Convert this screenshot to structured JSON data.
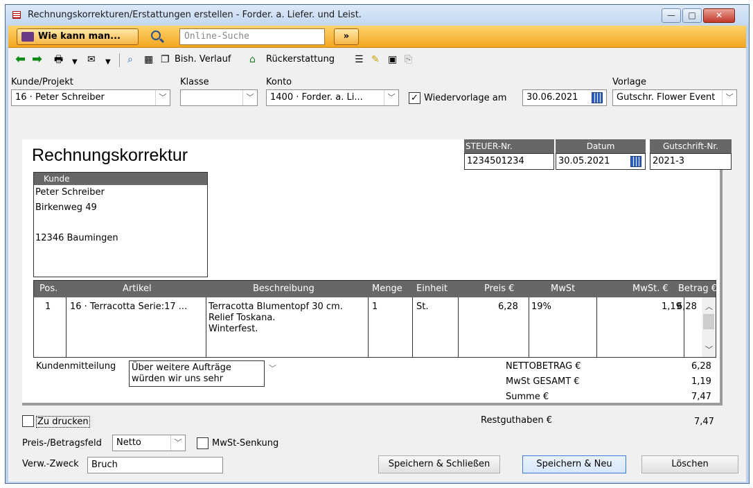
{
  "window": {
    "title": "Rechnungskorrekturen/Erstattungen erstellen - Forder. a. Liefer. und Leist.",
    "minimize": "—",
    "maximize": "□",
    "close": "✕"
  },
  "helpbar": {
    "howto": "Wie kann man...",
    "search_placeholder": "Online-Suche",
    "go": "»"
  },
  "toolbar": {
    "history": "Bish. Verlauf",
    "refund": "Rückerstattung"
  },
  "fields": {
    "customer_label": "Kunde/Projekt",
    "customer_value": "16 · Peter Schreiber",
    "class_label": "Klasse",
    "class_value": "",
    "account_label": "Konto",
    "account_value": "1400 · Forder. a. Li...",
    "recurring_label": "Wiedervorlage am",
    "recurring_checked": "✓",
    "recurring_date": "30.06.2021",
    "template_label": "Vorlage",
    "template_value": "Gutschr. Flower Event"
  },
  "form": {
    "title": "Rechnungskorrektur",
    "tax_label": "STEUER-Nr.",
    "tax_value": "1234501234",
    "date_label": "Datum",
    "date_value": "30.05.2021",
    "credit_label": "Gutschrift-Nr.",
    "credit_value": "2021-3",
    "customer_box_label": "Kunde",
    "address": [
      "Peter Schreiber",
      "Birkenweg 49",
      "",
      "12346 Baumingen"
    ]
  },
  "table": {
    "columns": [
      "Pos.",
      "Artikel",
      "Beschreibung",
      "Menge",
      "Einheit",
      "Preis €",
      "MwSt",
      "MwSt. €",
      "Betrag €"
    ],
    "rows": [
      {
        "pos": "1",
        "article": "16 · Terracotta Serie:17 ...",
        "description": [
          "Terracotta Blumentopf 30 cm.",
          "Relief Toskana.",
          "Winterfest."
        ],
        "qty": "1",
        "unit": "St.",
        "price": "6,28",
        "vat": "19%",
        "vat_amount": "1,19",
        "amount": "6,28"
      }
    ]
  },
  "totals": {
    "message_label": "Kundenmitteilung",
    "message_value": [
      "Über weitere Aufträge",
      "würden wir uns sehr"
    ],
    "net_label": "NETTOBETRAG €",
    "net_value": "6,28",
    "vat_label": "MwSt GESAMT €",
    "vat_value": "1,19",
    "sum_label": "Summe €",
    "sum_value": "7,47",
    "rest_label": "Restguthaben €",
    "rest_value": "7,47"
  },
  "bottom": {
    "print_label": "Zu drucken",
    "pricefield_label": "Preis-/Betragsfeld",
    "pricefield_value": "Netto",
    "vatcut_label": "MwSt-Senkung",
    "purpose_label": "Verw.-Zweck",
    "purpose_value": "Bruch",
    "save_close": "Speichern & Schließen",
    "save_new": "Speichern & Neu",
    "delete": "Löschen"
  }
}
